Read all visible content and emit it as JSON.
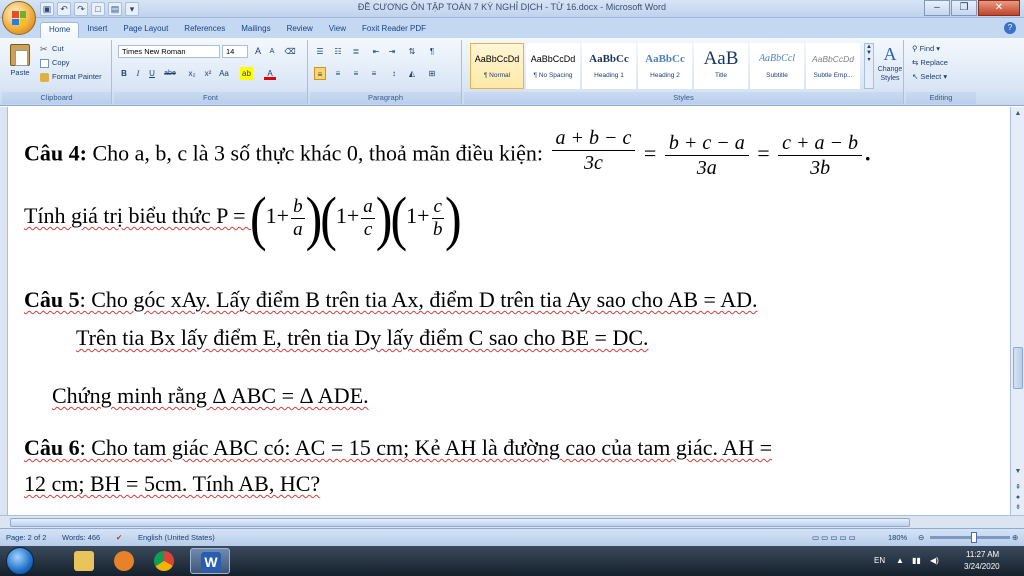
{
  "window": {
    "title": "ĐỀ CƯƠNG ÔN TẬP TOÁN 7 KỲ NGHỈ DỊCH - TỪ 16.docx - Microsoft Word",
    "minimize": "–",
    "restore": "❐",
    "close": "✕"
  },
  "tabs": [
    "Home",
    "Insert",
    "Page Layout",
    "References",
    "Mailings",
    "Review",
    "View",
    "Foxit Reader PDF"
  ],
  "active_tab": "Home",
  "clipboard": {
    "paste": "Paste",
    "cut": "Cut",
    "copy": "Copy",
    "format_painter": "Format Painter",
    "label": "Clipboard"
  },
  "font": {
    "name": "Times New Roman",
    "size": "14",
    "label": "Font",
    "grow": "A",
    "shrink": "A",
    "bold": "B",
    "italic": "I",
    "underline": "U",
    "strike": "abe",
    "sub": "x₂",
    "sup": "x²",
    "case": "Aa",
    "highlight": "ab",
    "color": "A"
  },
  "paragraph": {
    "label": "Paragraph",
    "show_marks": "¶"
  },
  "styles": {
    "label": "Styles",
    "items": [
      {
        "preview": "AaBbCcDd",
        "name": "¶ Normal"
      },
      {
        "preview": "AaBbCcDd",
        "name": "¶ No Spacing"
      },
      {
        "preview": "AaBbCc",
        "name": "Heading 1"
      },
      {
        "preview": "AaBbCc",
        "name": "Heading 2"
      },
      {
        "preview": "AaB",
        "name": "Title"
      },
      {
        "preview": "AaBbCcl",
        "name": "Subtitle"
      },
      {
        "preview": "AaBbCcDd",
        "name": "Subtle Emp..."
      }
    ],
    "change_styles": "Change Styles",
    "change_icon": "A"
  },
  "editing": {
    "label": "Editing",
    "find": "Find",
    "replace": "Replace",
    "select": "Select"
  },
  "doc": {
    "q4_label": "Câu 4:",
    "q4_text": " Cho a, b, c là 3 số thực khác 0, thoả mãn điều kiện: ",
    "frac1_num": "a + b − c",
    "frac1_den": "3c",
    "frac2_num": "b + c − a",
    "frac2_den": "3a",
    "frac3_num": "c + a − b",
    "frac3_den": "3b",
    "eq": "=",
    "dot": ".",
    "q4b_text": "Tính giá trị biểu thức P = ",
    "one_plus": "1+",
    "b": "b",
    "a": "a",
    "c": "c",
    "lparen": "(",
    "rparen": ")",
    "q5_label": "Câu 5",
    "q5_text": ": Cho góc xAy. Lấy điểm B trên tia Ax, điểm D trên tia Ay sao cho AB = AD.",
    "q5_line2": "Trên tia Bx lấy điểm E, trên tia Dy lấy điểm C sao cho BE = DC.",
    "q5_line3": "Chứng minh rằng  Δ ABC = Δ ADE.",
    "q6_label": "Câu 6",
    "q6_text": ":  Cho tam giác ABC có: AC = 15 cm; Kẻ AH là đường cao của tam giác. AH =",
    "q6_line2": "12 cm; BH = 5cm. Tính AB, HC?"
  },
  "status": {
    "page": "Page: 2 of 2",
    "words": "Words: 466",
    "language": "English (United States)",
    "zoom": "180%",
    "zoom_fraction": 0.55
  },
  "taskbar": {
    "lang": "EN",
    "time": "11:27 AM",
    "date": "3/24/2020"
  }
}
